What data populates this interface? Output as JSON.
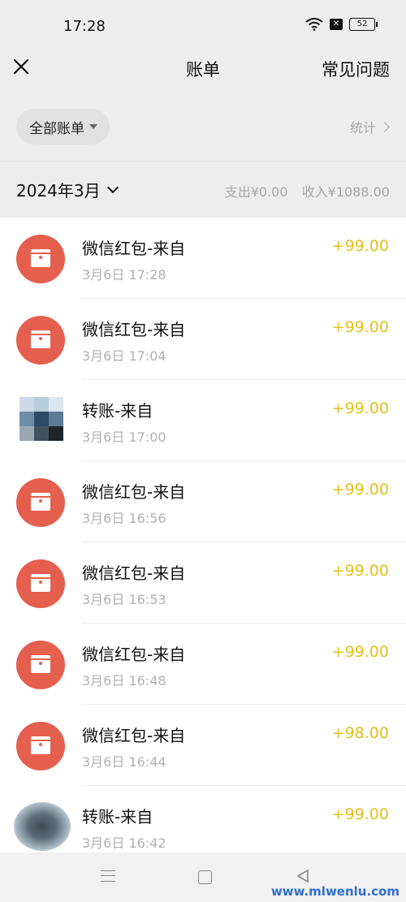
{
  "status_bar": {
    "time": "17:28",
    "battery": "52",
    "x_badge": "✕"
  },
  "nav": {
    "title": "账单",
    "faq": "常见问题"
  },
  "filter": {
    "chip": "全部账单",
    "stats": "统计"
  },
  "month": {
    "label": "2024年3月",
    "expense": "支出¥0.00",
    "income": "收入¥1088.00"
  },
  "transactions": [
    {
      "type": "red-packet",
      "title": "微信红包-来自",
      "time": "3月6日 17:28",
      "amount": "+99.00"
    },
    {
      "type": "red-packet",
      "title": "微信红包-来自",
      "time": "3月6日 17:04",
      "amount": "+99.00"
    },
    {
      "type": "transfer",
      "title": "转账-来自",
      "time": "3月6日 17:00",
      "amount": "+99.00"
    },
    {
      "type": "red-packet",
      "title": "微信红包-来自",
      "time": "3月6日 16:56",
      "amount": "+99.00"
    },
    {
      "type": "red-packet",
      "title": "微信红包-来自",
      "time": "3月6日 16:53",
      "amount": "+99.00"
    },
    {
      "type": "red-packet",
      "title": "微信红包-来自",
      "time": "3月6日 16:48",
      "amount": "+99.00"
    },
    {
      "type": "red-packet",
      "title": "微信红包-来自",
      "time": "3月6日 16:44",
      "amount": "+98.00"
    },
    {
      "type": "transfer",
      "title": "转账-来自",
      "time": "3月6日 16:42",
      "amount": "+99.00"
    }
  ],
  "watermark": "www.mlwenlu.com",
  "colors": {
    "accent_amount": "#e4bf19",
    "red_packet": "#e55f4e",
    "background": "#ededed"
  }
}
